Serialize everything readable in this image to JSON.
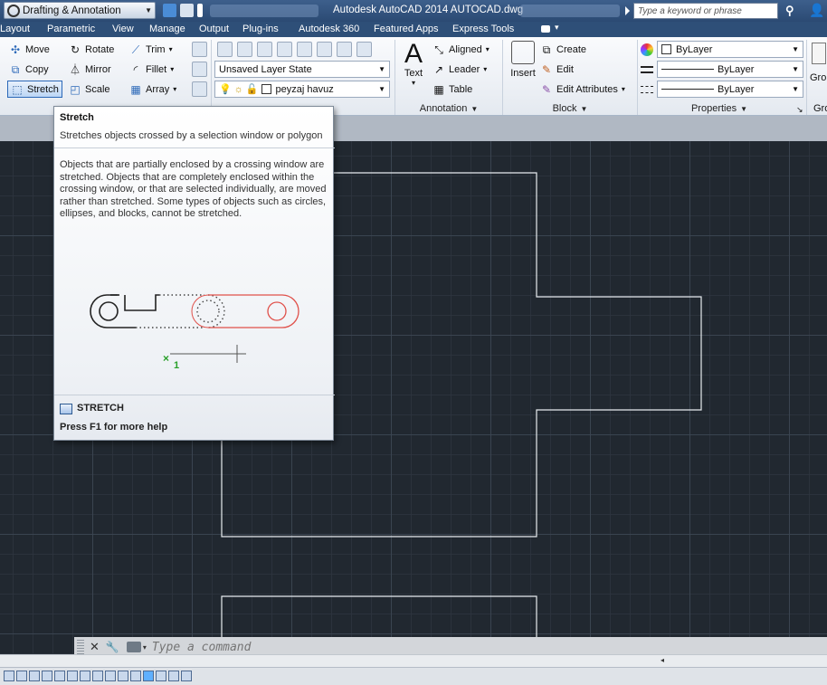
{
  "titlebar": {
    "workspace": "Drafting & Annotation",
    "title": "Autodesk AutoCAD 2014    AUTOCAD.dwg",
    "search_placeholder": "Type a keyword or phrase"
  },
  "menu_tabs": [
    "Layout",
    "Parametric",
    "View",
    "Manage",
    "Output",
    "Plug-ins",
    "Autodesk 360",
    "Featured Apps",
    "Express Tools"
  ],
  "ribbon": {
    "modify": {
      "move": "Move",
      "rotate": "Rotate",
      "trim": "Trim",
      "copy": "Copy",
      "mirror": "Mirror",
      "fillet": "Fillet",
      "stretch": "Stretch",
      "scale": "Scale",
      "array": "Array"
    },
    "layers": {
      "layer_state": "Unsaved Layer State",
      "current_layer": "peyzaj havuz"
    },
    "annotation": {
      "text": "Text",
      "aligned": "Aligned",
      "leader": "Leader",
      "table": "Table",
      "panel": "Annotation"
    },
    "block": {
      "insert": "Insert",
      "create": "Create",
      "edit": "Edit",
      "edit_attributes": "Edit Attributes",
      "panel": "Block"
    },
    "properties": {
      "color": "ByLayer",
      "linetype": "ByLayer",
      "lineweight": "ByLayer",
      "panel": "Properties"
    },
    "groups": {
      "button": "Grou",
      "panel": "Gro"
    }
  },
  "tooltip": {
    "title": "Stretch",
    "short": "Stretches objects crossed by a selection window or polygon",
    "long": "Objects that are partially enclosed by a crossing window are stretched. Objects that are completely enclosed within the crossing window, or that are selected individually, are moved rather than stretched. Some types of objects such as circles, ellipses, and blocks, cannot be stretched.",
    "illustration_label": "1",
    "command": "STRETCH",
    "help": "Press F1 for more help"
  },
  "command_line": {
    "placeholder": "Type a command"
  },
  "colors": {
    "canvas": "#212830",
    "titlebar": "#2e4f78",
    "highlight": "#2b68b8"
  }
}
